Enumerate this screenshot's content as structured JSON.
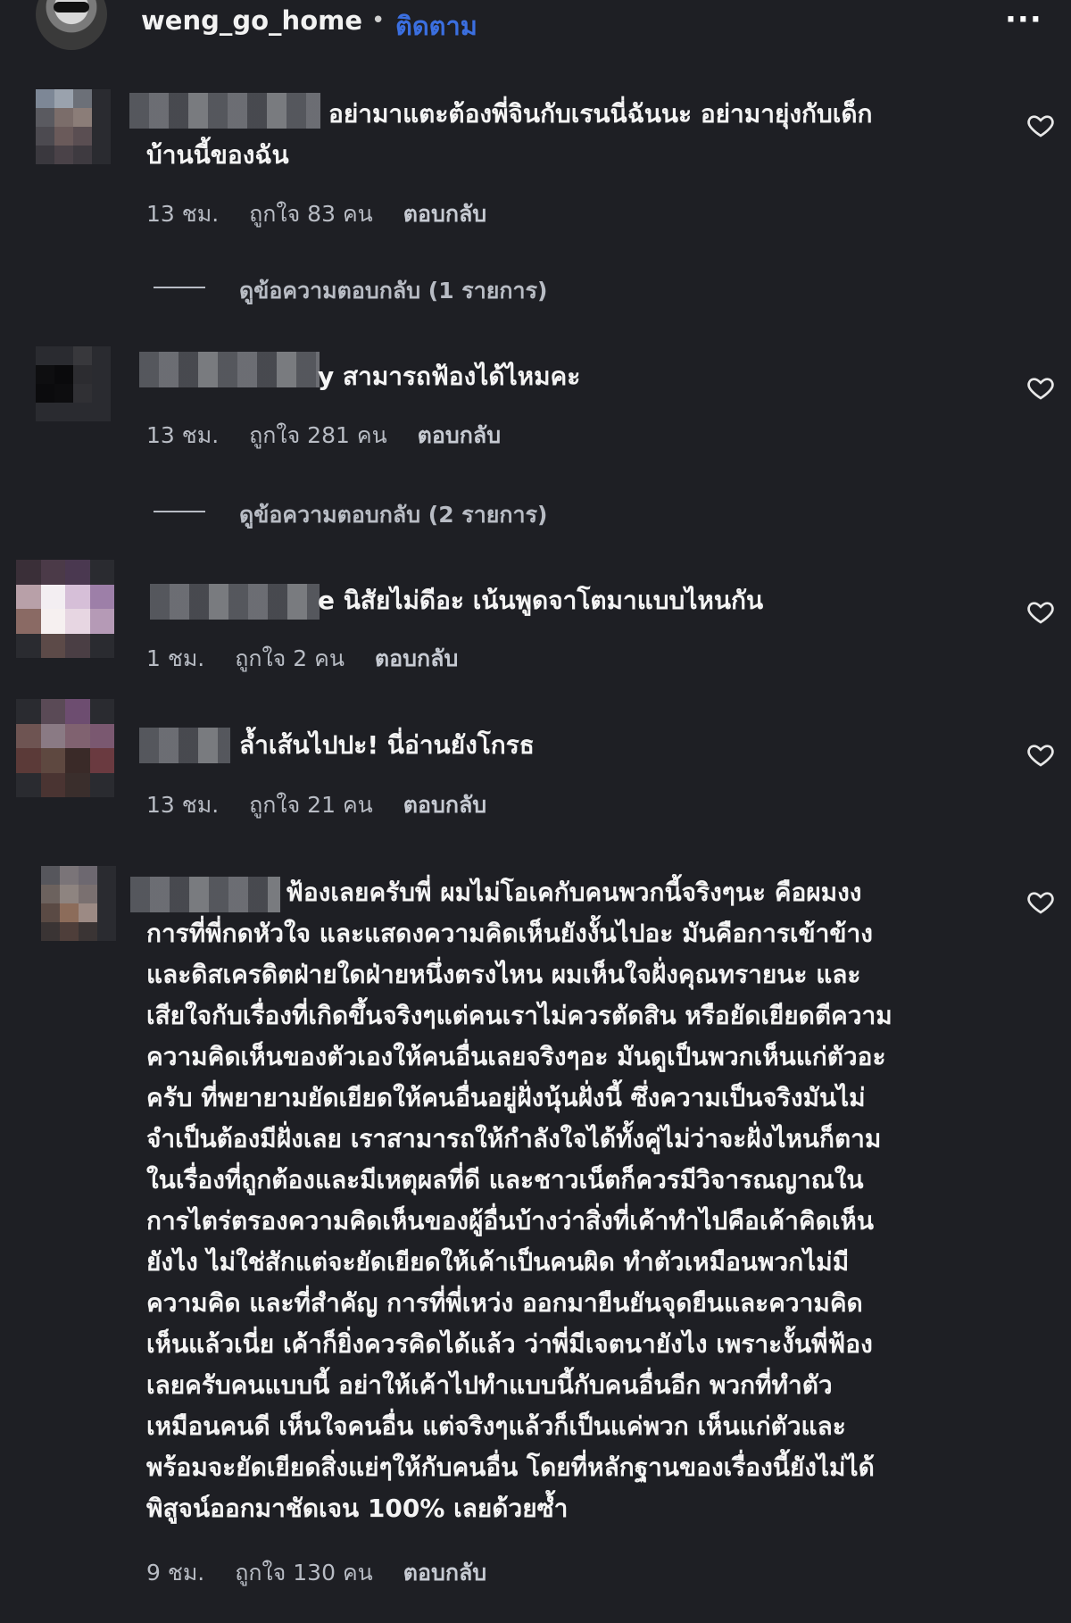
{
  "header": {
    "username": "weng_go_home",
    "separator": "•",
    "follow_label": "ติดตาม",
    "more_label": "···"
  },
  "comments": [
    {
      "text_lines": [
        "อย่ามาแตะต้องพี่จินกับเรนนี่ฉันนะ อย่ามายุ่งกับเด็ก",
        "บ้านนี้ของฉัน"
      ],
      "time": "13 ชม.",
      "likes": "ถูกใจ 83 คน",
      "reply": "ตอบกลับ",
      "view_replies": "ดูข้อความตอบกลับ (1 รายการ)"
    },
    {
      "text_lines": [
        "y สามารถฟ้องได้ไหมคะ"
      ],
      "time": "13 ชม.",
      "likes": "ถูกใจ 281 คน",
      "reply": "ตอบกลับ",
      "view_replies": "ดูข้อความตอบกลับ (2 รายการ)"
    },
    {
      "text_lines": [
        "e นิสัยไม่ดีอะ เน้นพูดจาโตมาแบบไหนกัน"
      ],
      "time": "1 ชม.",
      "likes": "ถูกใจ 2 คน",
      "reply": "ตอบกลับ"
    },
    {
      "text_lines": [
        "ล้ำเส้นไปปะ! นี่อ่านยังโกรธ"
      ],
      "time": "13 ชม.",
      "likes": "ถูกใจ 21 คน",
      "reply": "ตอบกลับ"
    },
    {
      "text_lines": [
        "ฟ้องเลยครับพี่ ผมไม่โอเคกับคนพวกนี้จริงๆนะ คือผมงง",
        "การที่พี่กดหัวใจ และแสดงความคิดเห็นยังงั้นไปอะ มันคือการเข้าข้าง",
        "และดิสเครดิตฝ่ายใดฝ่ายหนึ่งตรงไหน ผมเห็นใจฝั่งคุณทรายนะ และ",
        "เสียใจกับเรื่องที่เกิดขึ้นจริงๆแต่คนเราไม่ควรตัดสิน หรือยัดเยียดตีความ",
        "ความคิดเห็นของตัวเองให้คนอื่นเลยจริงๆอะ มันดูเป็นพวกเห็นแก่ตัวอะ",
        "ครับ ที่พยายามยัดเยียดให้คนอื่นอยู่ฝั่งนุ้นฝั่งนี้ ซึ่งความเป็นจริงมันไม่",
        "จำเป็นต้องมีฝั่งเลย เราสามารถให้กำลังใจได้ทั้งคู่ไม่ว่าจะฝั่งไหนก็ตาม",
        "ในเรื่องที่ถูกต้องและมีเหตุผลที่ดี และชาวเน็ตก็ควรมีวิจารณญาณใน",
        "การไตร่ตรองความคิดเห็นของผู้อื่นบ้างว่าสิ่งที่เค้าทำไปคือเค้าคิดเห็น",
        "ยังไง ไม่ใช่สักแต่จะยัดเยียดให้เค้าเป็นคนผิด ทำตัวเหมือนพวกไม่มี",
        "ความคิด และที่สำคัญ การที่พี่เหว่ง ออกมายืนยันจุดยืนและความคิด",
        "เห็นแล้วเนี่ย เค้าก็ยิ่งควรคิดได้แล้ว ว่าพี่มีเจตนายังไง เพราะงั้นพี่ฟ้อง",
        "เลยครับคนแบบนี้ อย่าให้เค้าไปทำแบบนี้กับคนอื่นอีก พวกที่ทำตัว",
        "เหมือนคนดี เห็นใจคนอื่น แต่จริงๆแล้วก็เป็นแค่พวก เห็นแก่ตัวและ",
        "พร้อมจะยัดเยียดสิ่งแย่ๆให้กับคนอื่น โดยที่หลักฐานของเรื่องนี้ยังไม่ได้",
        "พิสูจน์ออกมาชัดเจน 100% เลยด้วยซ้ำ"
      ],
      "time": "9 ชม.",
      "likes": "ถูกใจ 130 คน",
      "reply": "ตอบกลับ"
    }
  ]
}
